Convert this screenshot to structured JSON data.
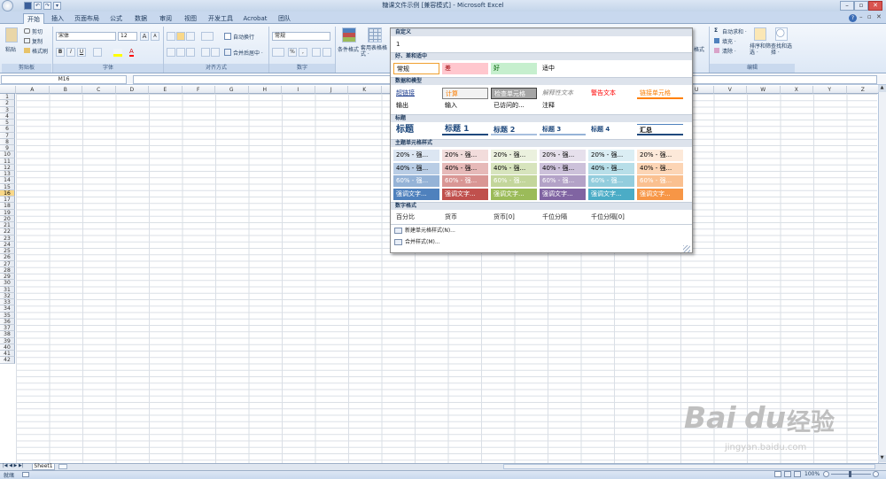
{
  "window": {
    "title": "糖课文件示例 [兼容模式] - Microsoft Excel",
    "min": "–",
    "max": "▫",
    "close": "✕",
    "help": "?"
  },
  "qat": {
    "undo": "↶",
    "redo": "↷",
    "save": "▾"
  },
  "tabs": [
    "开始",
    "插入",
    "页面布局",
    "公式",
    "数据",
    "审阅",
    "视图",
    "开发工具",
    "Acrobat",
    "团队"
  ],
  "active_tab": "开始",
  "ribbon": {
    "clipboard": {
      "paste": "粘贴",
      "cut": "剪切",
      "copy": "复制",
      "format_painter": "格式刷",
      "label": "剪贴板"
    },
    "font": {
      "name": "宋体",
      "size": "12",
      "grow": "A",
      "shrink": "A",
      "bold": "B",
      "italic": "I",
      "underline": "U",
      "label": "字体"
    },
    "alignment": {
      "wrap": "自动换行",
      "merge": "合并后居中 ·",
      "label": "对齐方式"
    },
    "number": {
      "format": "常规",
      "pct": "%",
      "comma": ",",
      "label": "数字"
    },
    "styles": {
      "conditional": "条件格式",
      "table": "套用表格格式 ·",
      "partial_format": "格式"
    },
    "editing": {
      "autosum": "自动求和 ·",
      "fill": "填充 ·",
      "clear": "清除 ·",
      "sort": "排序和筛选 ·",
      "find": "查找和选择 ·",
      "label": "编辑"
    }
  },
  "name_box": "M16",
  "fx_label": "fx",
  "columns": [
    "A",
    "B",
    "C",
    "D",
    "E",
    "F",
    "G",
    "H",
    "I",
    "J",
    "K",
    "L",
    "M",
    "N",
    "O",
    "P",
    "Q",
    "R",
    "S",
    "T",
    "U",
    "V",
    "W",
    "X",
    "Y",
    "Z"
  ],
  "rows": [
    "1",
    "2",
    "3",
    "4",
    "5",
    "6",
    "7",
    "8",
    "9",
    "10",
    "11",
    "12",
    "13",
    "14",
    "15",
    "16",
    "17",
    "18",
    "19",
    "20",
    "21",
    "22",
    "23",
    "24",
    "25",
    "26",
    "27",
    "28",
    "29",
    "30",
    "31",
    "32",
    "33",
    "34",
    "35",
    "36",
    "37",
    "38",
    "39",
    "40",
    "41",
    "42"
  ],
  "selected_row": "16",
  "gallery": {
    "custom": {
      "title": "自定义",
      "items": [
        "1"
      ]
    },
    "good_bad": {
      "title": "好、差和适中",
      "items": [
        {
          "label": "常规",
          "bg": "#ffffff",
          "fg": "#000000",
          "border": "#f0a030"
        },
        {
          "label": "差",
          "bg": "#ffc7ce",
          "fg": "#9c0006"
        },
        {
          "label": "好",
          "bg": "#c6efce",
          "fg": "#006100"
        },
        {
          "label": "适中",
          "bg": "#ffffff",
          "fg": "#000000"
        }
      ]
    },
    "data_model": {
      "title": "数据和模型",
      "rows": [
        [
          {
            "label": "超链接",
            "fg": "#1f3f8f",
            "u": true
          },
          {
            "label": "计算",
            "bg": "#f2f2f2",
            "fg": "#fa7d00",
            "border": "#7f7f7f"
          },
          {
            "label": "检查单元格",
            "bg": "#a5a5a5",
            "fg": "#ffffff",
            "border": "#3f3f3f"
          },
          {
            "label": "解释性文本",
            "fg": "#7f7f7f",
            "i": true
          },
          {
            "label": "警告文本",
            "fg": "#ff0000"
          },
          {
            "label": "链接单元格",
            "fg": "#fa7d00",
            "ub": "#ff8001"
          }
        ],
        [
          {
            "label": "输出"
          },
          {
            "label": "输入"
          },
          {
            "label": "已访问的..."
          },
          {
            "label": "注释"
          }
        ]
      ]
    },
    "titles": {
      "title": "标题",
      "items": [
        {
          "label": "标题",
          "size": 10,
          "ub": "#ffffff"
        },
        {
          "label": "标题 1",
          "size": 9,
          "ub": "#1f497d"
        },
        {
          "label": "标题 2",
          "size": 8,
          "ub": "#a7bfde"
        },
        {
          "label": "标题 3",
          "size": 7,
          "ub": "#95b3d7"
        },
        {
          "label": "标题 4",
          "size": 7
        },
        {
          "label": "汇总",
          "size": 7,
          "ub": "#1f497d"
        }
      ]
    },
    "theme": {
      "title": "主题单元格样式",
      "rows": [
        {
          "label": "20% - 强...",
          "bgs": [
            "#dce6f2",
            "#f2dcdb",
            "#ebf1de",
            "#e6e0ec",
            "#dbeef4",
            "#fde9d9"
          ],
          "fg": "#000000"
        },
        {
          "label": "40% - 强...",
          "bgs": [
            "#b9cde5",
            "#e6b9b8",
            "#d7e4bd",
            "#ccc1da",
            "#b7dee8",
            "#fcd5b5"
          ],
          "fg": "#000000"
        },
        {
          "label": "60% - 强...",
          "bgs": [
            "#95b3d7",
            "#d99694",
            "#c3d69b",
            "#b3a2c7",
            "#93cddd",
            "#fac090"
          ],
          "fg": "#ffffff"
        },
        {
          "label": "强调文字...",
          "bgs": [
            "#4f81bd",
            "#c0504d",
            "#9bbb59",
            "#8064a2",
            "#4bacc6",
            "#f79646"
          ],
          "fg": "#ffffff"
        }
      ]
    },
    "number": {
      "title": "数字格式",
      "items": [
        "百分比",
        "货币",
        "货币[0]",
        "千位分隔",
        "千位分隔[0]"
      ]
    },
    "new_style": "新建单元格样式(N)...",
    "merge_style": "合并样式(M)..."
  },
  "sheet_tab": "Sheet1",
  "status": {
    "ready": "就绪",
    "zoom": "100%"
  },
  "watermark": {
    "brand": "Bai",
    "paw": "du",
    "cn": "经验",
    "url": "jingyan.baidu.com"
  }
}
